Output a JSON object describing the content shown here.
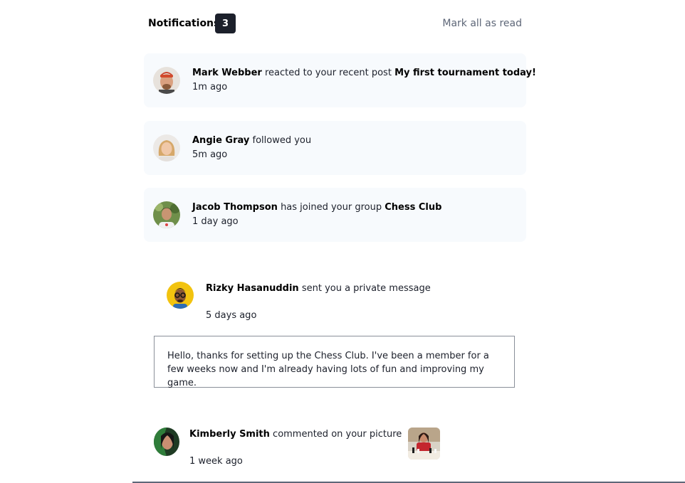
{
  "header": {
    "title": "Notifications",
    "unread_count": "3",
    "mark_all_label": "Mark all as read"
  },
  "notifications": [
    {
      "name": "Mark Webber",
      "action": "reacted to your recent post",
      "object": "My first tournament today!",
      "time": "1m ago",
      "avatar_icon": "avatar-mark-webber"
    },
    {
      "name": "Angie Gray",
      "action": "followed you",
      "object": "",
      "time": "5m ago",
      "avatar_icon": "avatar-angie-gray"
    },
    {
      "name": "Jacob Thompson",
      "action": "has joined your group",
      "object": "Chess Club",
      "time": "1 day ago",
      "avatar_icon": "avatar-jacob-thompson"
    }
  ],
  "private_message": {
    "name": "Rizky Hasanuddin",
    "action": "sent you a private message",
    "time": "5 days ago",
    "message": "Hello, thanks for setting up the Chess Club. I've been a member for a few weeks now and I'm already having lots of fun and improving my game.",
    "avatar_icon": "avatar-rizky-hasanuddin"
  },
  "comment": {
    "name": "Kimberly Smith",
    "action": "commented on your picture",
    "time": "1 week ago",
    "avatar_icon": "avatar-kimberly-smith",
    "thumbnail_icon": "chess-picture-thumbnail"
  },
  "colors": {
    "card_bg": "#f7fafd",
    "badge_bg": "#1c202b",
    "muted_text": "#5e6778"
  }
}
